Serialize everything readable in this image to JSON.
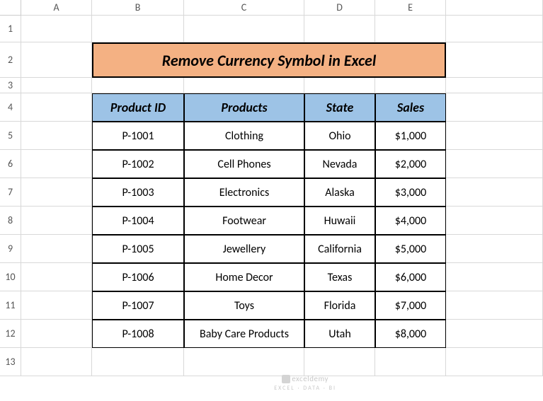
{
  "columns": [
    "A",
    "B",
    "C",
    "D",
    "E"
  ],
  "rows": [
    "1",
    "2",
    "3",
    "4",
    "5",
    "6",
    "7",
    "8",
    "9",
    "10",
    "11",
    "12",
    "13"
  ],
  "title": "Remove Currency Symbol in Excel",
  "headers": {
    "col1": "Product ID",
    "col2": "Products",
    "col3": "State",
    "col4": "Sales"
  },
  "data": [
    {
      "id": "P-1001",
      "product": "Clothing",
      "state": "Ohio",
      "sales": "$1,000"
    },
    {
      "id": "P-1002",
      "product": "Cell Phones",
      "state": "Nevada",
      "sales": "$2,000"
    },
    {
      "id": "P-1003",
      "product": "Electronics",
      "state": "Alaska",
      "sales": "$3,000"
    },
    {
      "id": "P-1004",
      "product": "Footwear",
      "state": "Huwaii",
      "sales": "$4,000"
    },
    {
      "id": "P-1005",
      "product": "Jewellery",
      "state": "California",
      "sales": "$5,000"
    },
    {
      "id": "P-1006",
      "product": "Home Decor",
      "state": "Texas",
      "sales": "$6,000"
    },
    {
      "id": "P-1007",
      "product": "Toys",
      "state": "Florida",
      "sales": "$7,000"
    },
    {
      "id": "P-1008",
      "product": "Baby Care Products",
      "state": "Utah",
      "sales": "$8,000"
    }
  ],
  "watermark": {
    "line1": "exceldemy",
    "line2": "EXCEL · DATA · BI"
  }
}
